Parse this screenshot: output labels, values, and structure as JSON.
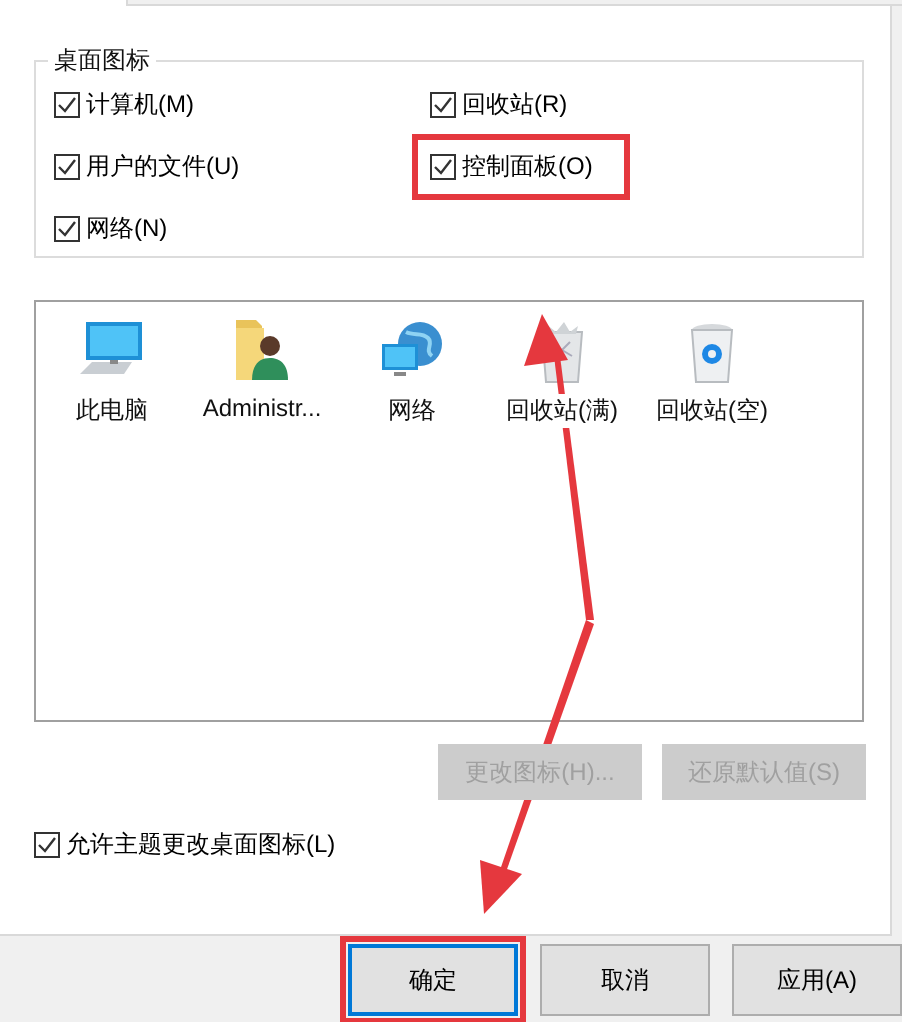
{
  "group_box": {
    "title": "桌面图标",
    "checkboxes": [
      {
        "label": "计算机(M)",
        "checked": true,
        "highlighted": false
      },
      {
        "label": "回收站(R)",
        "checked": true,
        "highlighted": false
      },
      {
        "label": "用户的文件(U)",
        "checked": true,
        "highlighted": false
      },
      {
        "label": "控制面板(O)",
        "checked": true,
        "highlighted": true
      },
      {
        "label": "网络(N)",
        "checked": true,
        "highlighted": false
      }
    ]
  },
  "icons": [
    {
      "label": "此电脑",
      "kind": "computer"
    },
    {
      "label": "Administr...",
      "kind": "user-folder"
    },
    {
      "label": "网络",
      "kind": "network"
    },
    {
      "label": "回收站(满)",
      "kind": "bin-full"
    },
    {
      "label": "回收站(空)",
      "kind": "bin-empty"
    }
  ],
  "icon_buttons": [
    {
      "label": "更改图标(H)...",
      "disabled": true
    },
    {
      "label": "还原默认值(S)",
      "disabled": true
    }
  ],
  "theme_checkbox": {
    "label": "允许主题更改桌面图标(L)",
    "checked": true
  },
  "dialog_buttons": [
    {
      "label": "确定",
      "default": true,
      "highlighted": true
    },
    {
      "label": "取消",
      "default": false,
      "highlighted": false
    },
    {
      "label": "应用(A)",
      "default": false,
      "highlighted": false
    }
  ]
}
